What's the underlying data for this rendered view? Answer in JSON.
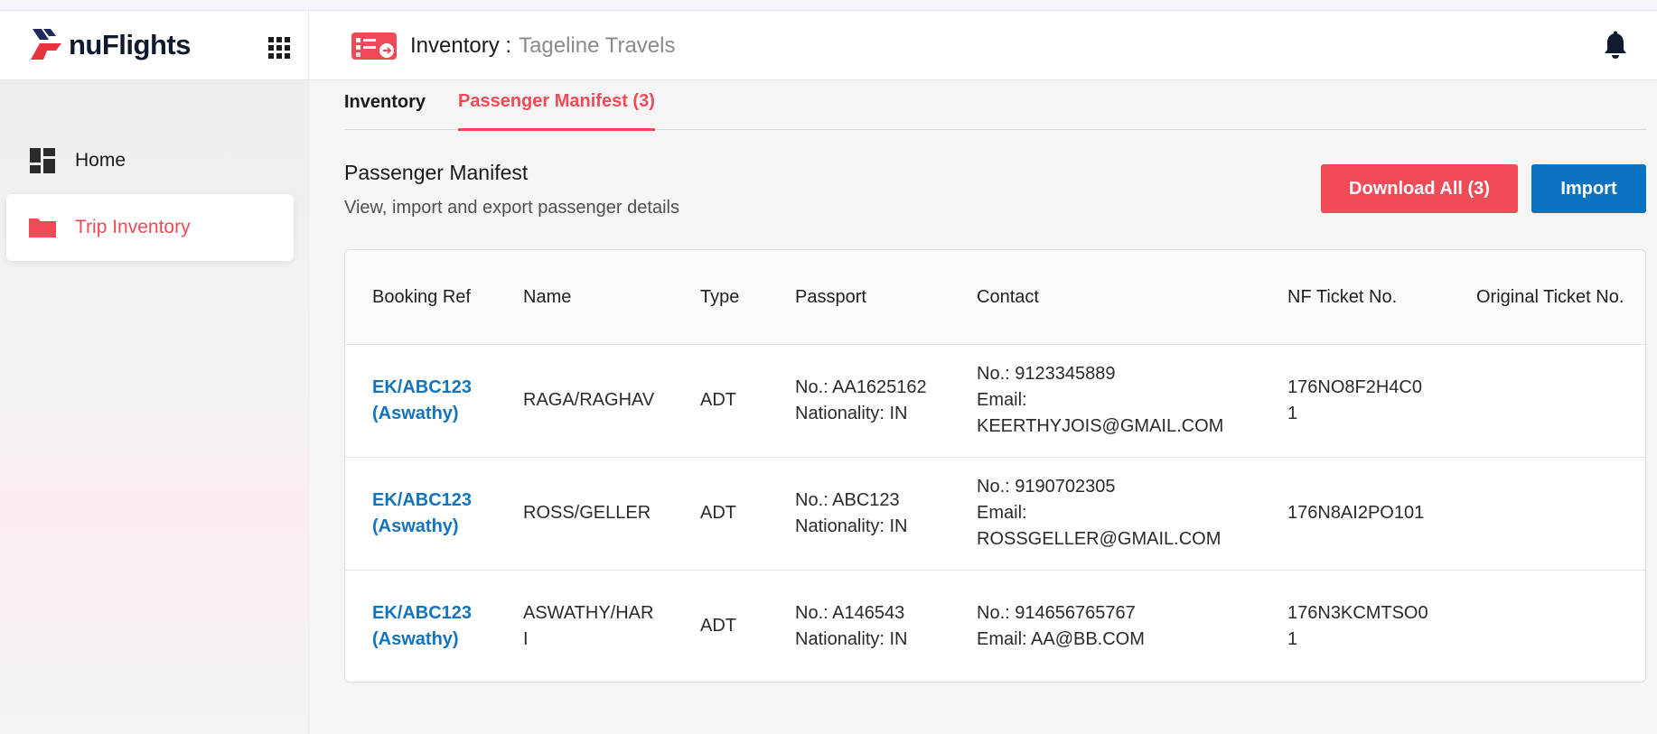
{
  "app": {
    "logo_text": "nuFlights",
    "title_main": "Inventory :",
    "title_sub": "Tageline Travels"
  },
  "sidebar": {
    "items": [
      {
        "label": "Home",
        "icon": "dashboard-icon"
      },
      {
        "label": "Trip Inventory",
        "icon": "folder-icon"
      }
    ]
  },
  "tabs": [
    {
      "label": "Inventory",
      "active": false
    },
    {
      "label": "Passenger Manifest (3)",
      "active": true
    }
  ],
  "section": {
    "title": "Passenger Manifest",
    "subtitle": "View, import and export passenger details"
  },
  "buttons": {
    "download": "Download All (3)",
    "import": "Import"
  },
  "table": {
    "headers": [
      "Booking Ref",
      "Name",
      "Type",
      "Passport",
      "Contact",
      "NF Ticket No.",
      "Original Ticket No."
    ],
    "rows": [
      {
        "booking_ref": "EK/ABC123 (Aswathy)",
        "name": "RAGA/RAGHAV",
        "type": "ADT",
        "passport_no": "No.: AA1625162",
        "nationality": "Nationality: IN",
        "contact_no": "No.: 9123345889",
        "contact_email": "Email: KEERTHYJOIS@GMAIL.COM",
        "nf_ticket": "176NO8F2H4C01",
        "original_ticket": ""
      },
      {
        "booking_ref": "EK/ABC123 (Aswathy)",
        "name": "ROSS/GELLER",
        "type": "ADT",
        "passport_no": "No.: ABC123",
        "nationality": "Nationality: IN",
        "contact_no": "No.: 9190702305",
        "contact_email": "Email: ROSSGELLER@GMAIL.COM",
        "nf_ticket": "176N8AI2PO101",
        "original_ticket": ""
      },
      {
        "booking_ref": "EK/ABC123 (Aswathy)",
        "name": "ASWATHY/HARI",
        "type": "ADT",
        "passport_no": "No.: A146543",
        "nationality": "Nationality: IN",
        "contact_no": "No.: 914656765767",
        "contact_email": "Email: AA@BB.COM",
        "nf_ticket": "176N3KCMTSO01",
        "original_ticket": ""
      }
    ]
  },
  "colors": {
    "accent_red": "#ef4a55",
    "primary_blue": "#0b73c0",
    "link_blue": "#1473bf",
    "logo_red": "#e8333f",
    "logo_navy": "#1f2a5a"
  }
}
